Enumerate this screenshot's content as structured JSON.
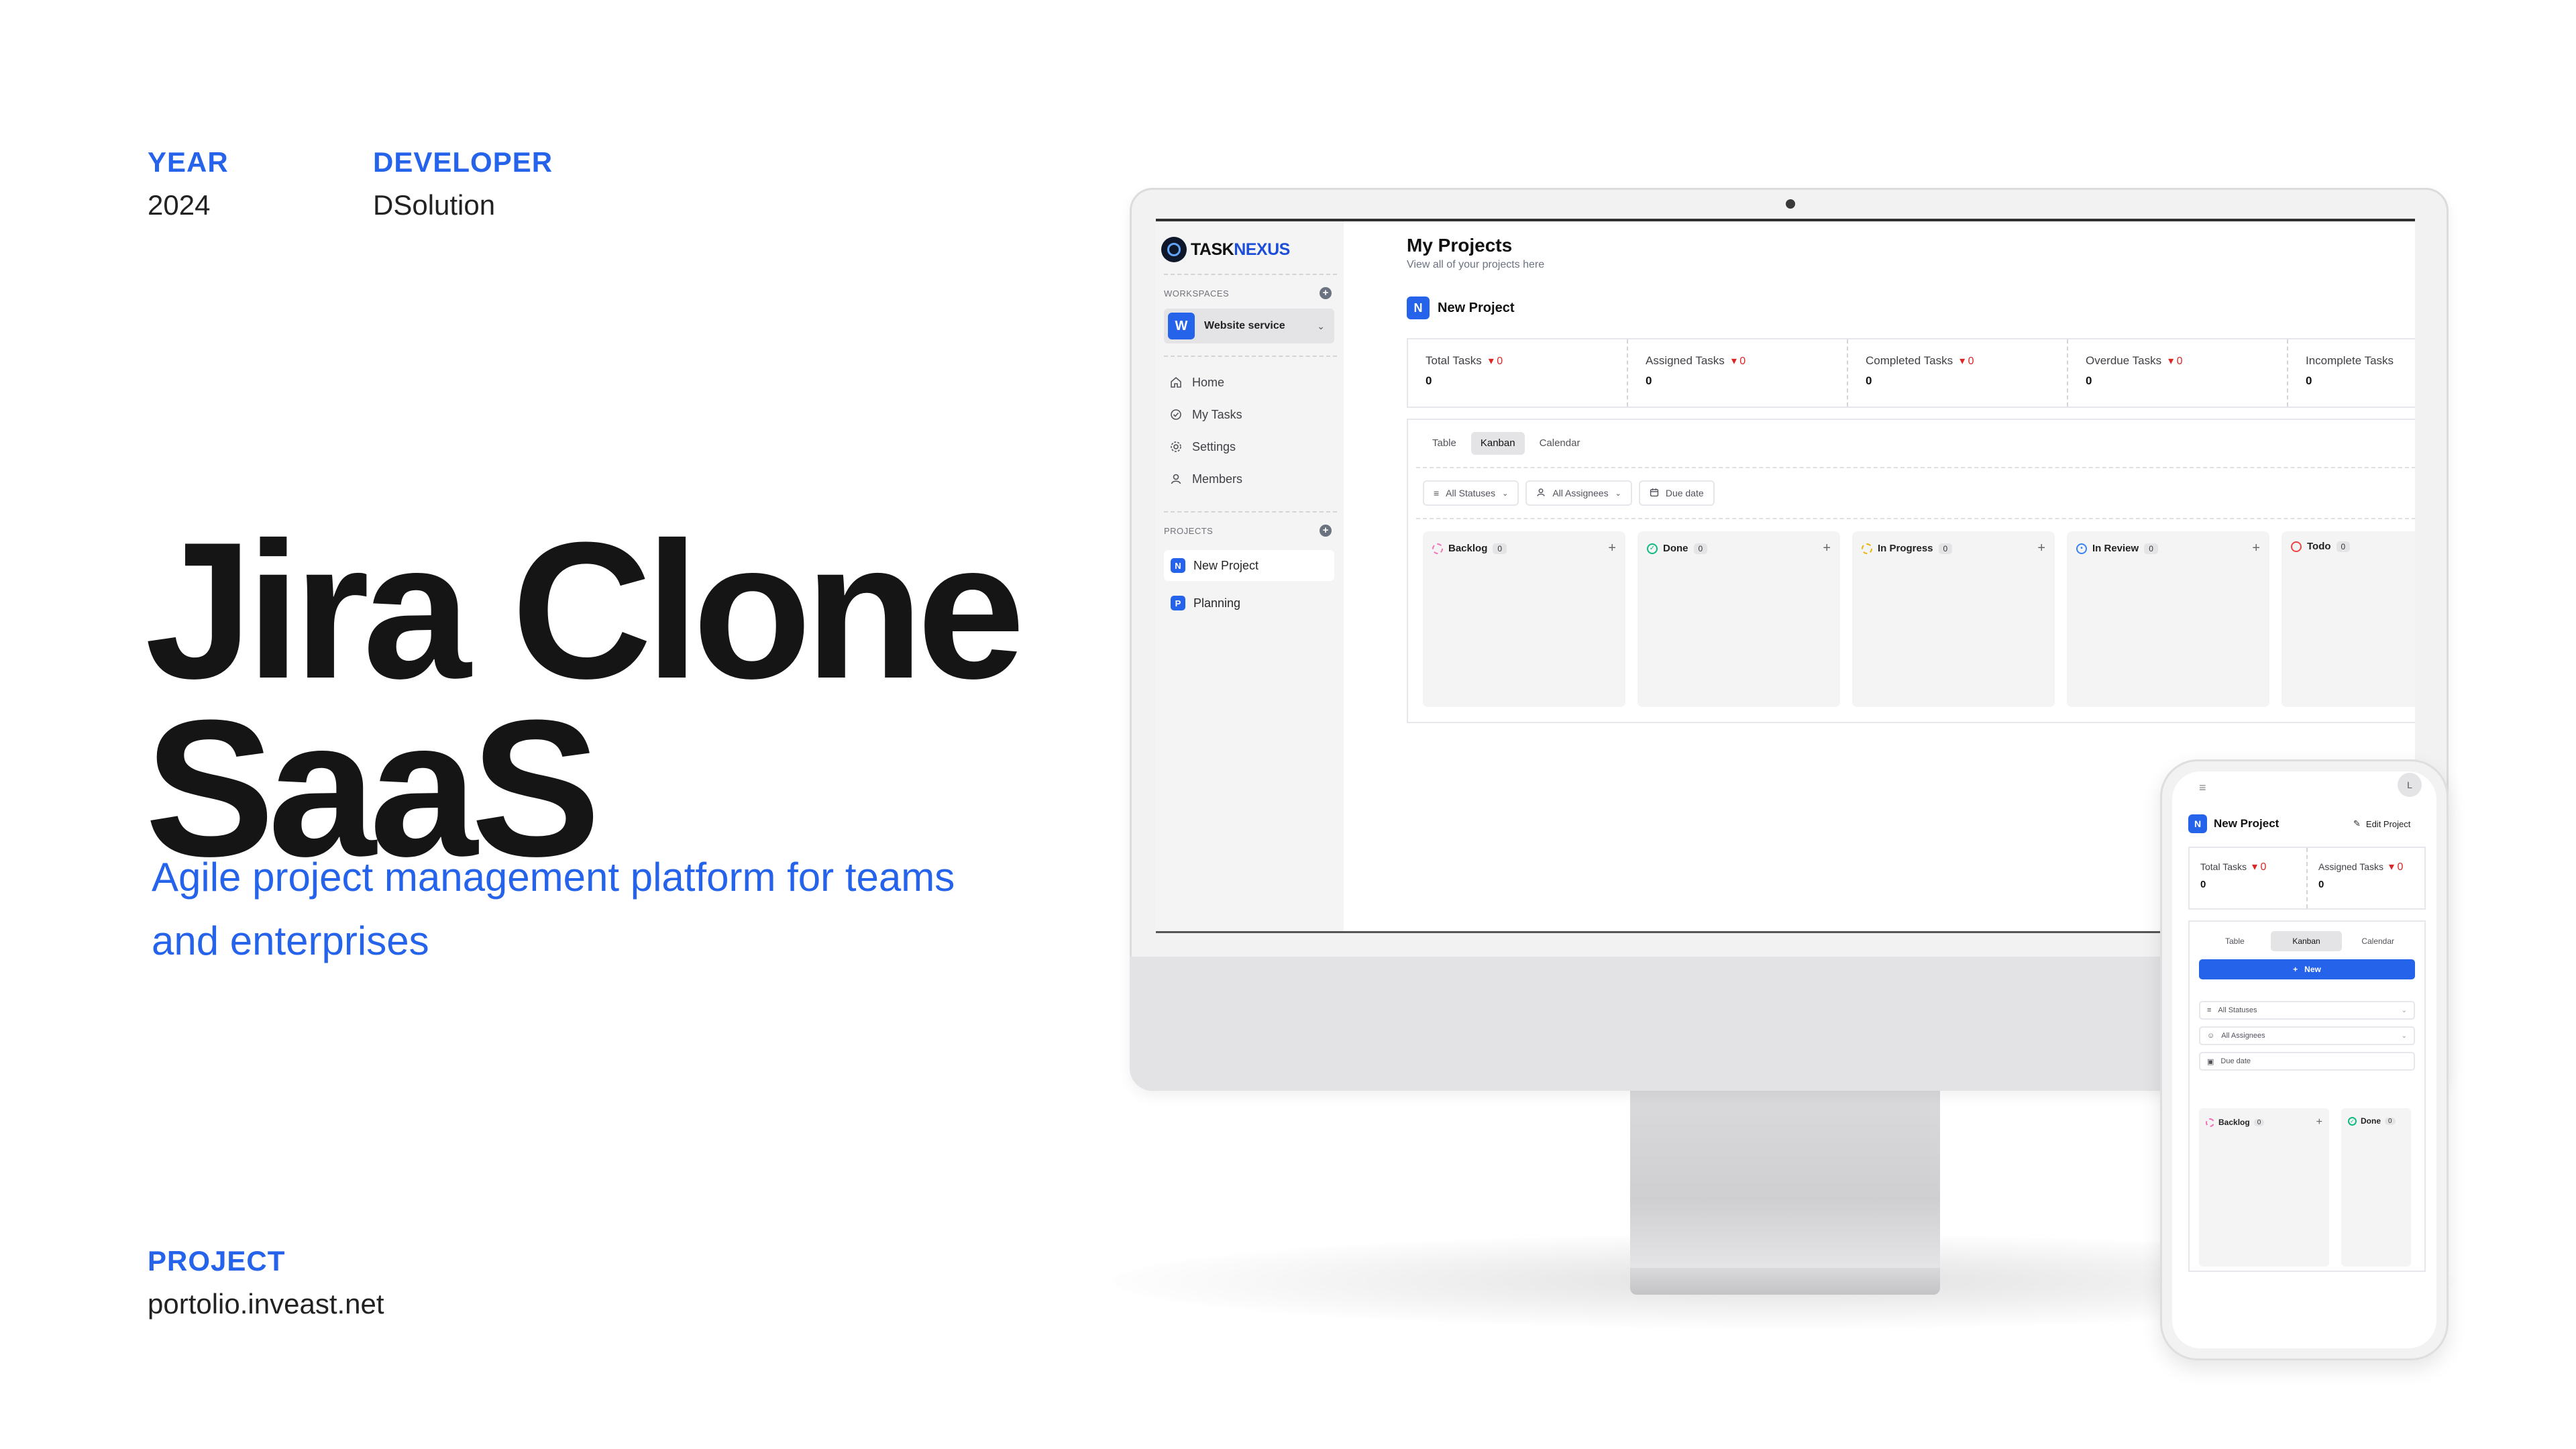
{
  "meta": {
    "year_label": "YEAR",
    "year_value": "2024",
    "developer_label": "DEVELOPER",
    "developer_value": "DSolution",
    "project_label": "PROJECT",
    "project_value": "portolio.inveast.net"
  },
  "hero": {
    "title_line1": "Jira Clone",
    "title_line2": "SaaS",
    "subtitle_line1": "Agile project management platform for teams",
    "subtitle_line2": "and enterprises"
  },
  "desktop_app": {
    "logo": {
      "part1": "TASK",
      "part2": "NEXUS"
    },
    "sidebar": {
      "workspaces_caption": "WORKSPACES",
      "workspace": {
        "badge": "W",
        "name": "Website service"
      },
      "nav": [
        {
          "label": "Home",
          "icon": "home-icon"
        },
        {
          "label": "My Tasks",
          "icon": "check-circle-icon"
        },
        {
          "label": "Settings",
          "icon": "gear-icon"
        },
        {
          "label": "Members",
          "icon": "user-icon"
        }
      ],
      "projects_caption": "PROJECTS",
      "projects": [
        {
          "badge": "N",
          "label": "New Project",
          "active": true
        },
        {
          "badge": "P",
          "label": "Planning",
          "active": false
        }
      ]
    },
    "main": {
      "title": "My Projects",
      "subtitle": "View all of your projects here",
      "project": {
        "badge": "N",
        "name": "New Project"
      },
      "stats": [
        {
          "label": "Total Tasks",
          "delta": "0",
          "value": "0"
        },
        {
          "label": "Assigned Tasks",
          "delta": "0",
          "value": "0"
        },
        {
          "label": "Completed Tasks",
          "delta": "0",
          "value": "0"
        },
        {
          "label": "Overdue Tasks",
          "delta": "0",
          "value": "0"
        },
        {
          "label": "Incomplete Tasks",
          "delta": "",
          "value": "0"
        }
      ],
      "tabs": [
        "Table",
        "Kanban",
        "Calendar"
      ],
      "active_tab": "Kanban",
      "filters": {
        "statuses": "All Statuses",
        "assignees": "All Assignees",
        "due_date": "Due date"
      },
      "columns": [
        {
          "name": "Backlog",
          "count": "0",
          "color": "#f472b6",
          "style": "dashed"
        },
        {
          "name": "Done",
          "count": "0",
          "color": "#10b981",
          "style": "check"
        },
        {
          "name": "In Progress",
          "count": "0",
          "color": "#eab308",
          "style": "dashed"
        },
        {
          "name": "In Review",
          "count": "0",
          "color": "#3b82f6",
          "style": "dot"
        },
        {
          "name": "Todo",
          "count": "0",
          "color": "#ef4444",
          "style": "ring"
        }
      ]
    }
  },
  "mobile_app": {
    "avatar": "L",
    "project": {
      "badge": "N",
      "name": "New Project"
    },
    "edit_label": "Edit Project",
    "stats": [
      {
        "label": "Total Tasks",
        "delta": "0",
        "value": "0"
      },
      {
        "label": "Assigned Tasks",
        "delta": "0",
        "value": "0"
      }
    ],
    "tabs": [
      "Table",
      "Kanban",
      "Calendar"
    ],
    "new_button": "New",
    "filters": {
      "statuses": "All Statuses",
      "assignees": "All Assignees",
      "due_date": "Due date"
    },
    "columns": [
      {
        "name": "Backlog",
        "count": "0"
      },
      {
        "name": "Done",
        "count": "0"
      }
    ]
  },
  "colors": {
    "accent": "#2563eb",
    "danger": "#dc2626",
    "ink": "#151515"
  }
}
